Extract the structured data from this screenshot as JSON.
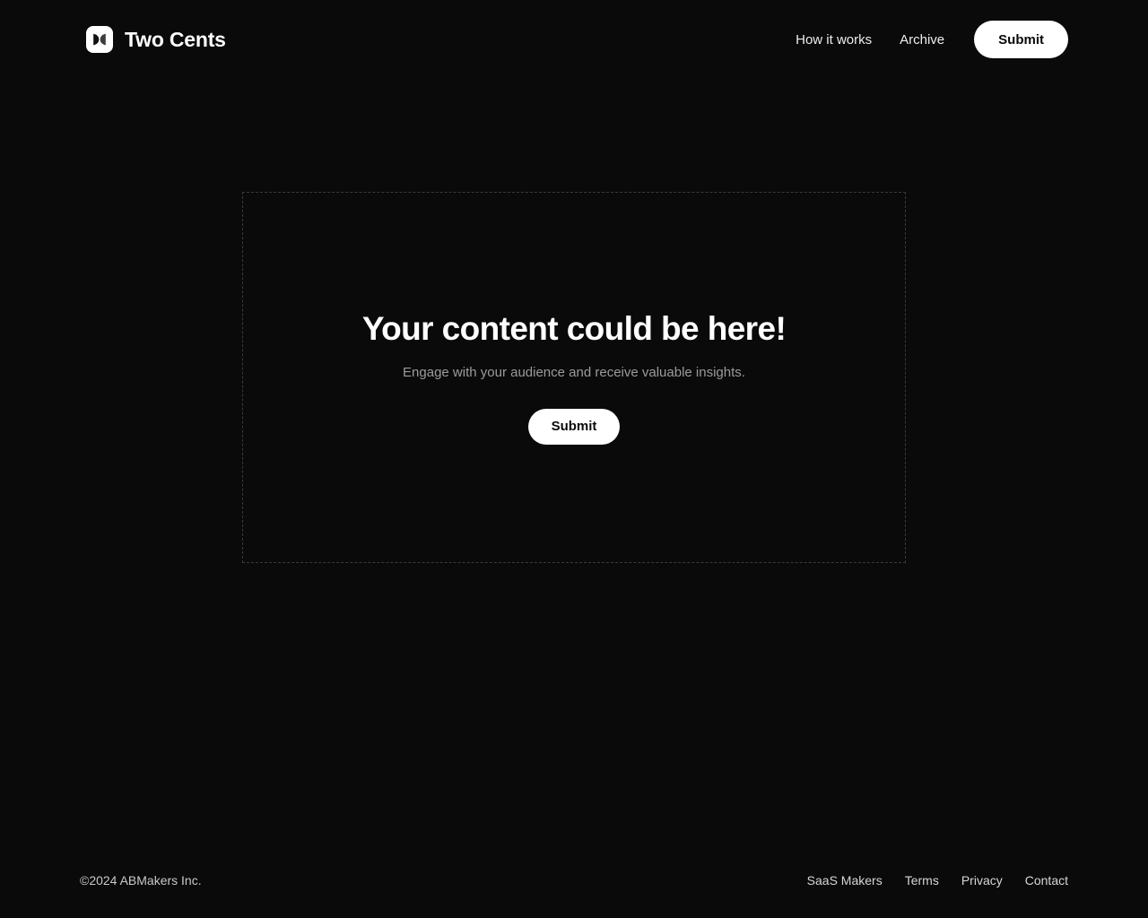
{
  "theme": {
    "background": "#0a0a0a",
    "text_primary": "#ffffff",
    "text_muted": "#9b9b9b",
    "accent_surface": "#ffffff",
    "accent_text": "#0a0a0a",
    "dashed_border": "#3a3a3a"
  },
  "header": {
    "brand": {
      "icon": "two-cents-logo-icon",
      "name": "Two Cents"
    },
    "nav": [
      {
        "label": "How it works"
      },
      {
        "label": "Archive"
      }
    ],
    "submit_label": "Submit"
  },
  "main": {
    "placeholder_card": {
      "title": "Your content could be here!",
      "subtitle": "Engage with your audience and receive valuable insights.",
      "submit_label": "Submit"
    }
  },
  "footer": {
    "copyright": "©2024 ABMakers Inc.",
    "links": [
      {
        "label": "SaaS Makers"
      },
      {
        "label": "Terms"
      },
      {
        "label": "Privacy"
      },
      {
        "label": "Contact"
      }
    ]
  }
}
